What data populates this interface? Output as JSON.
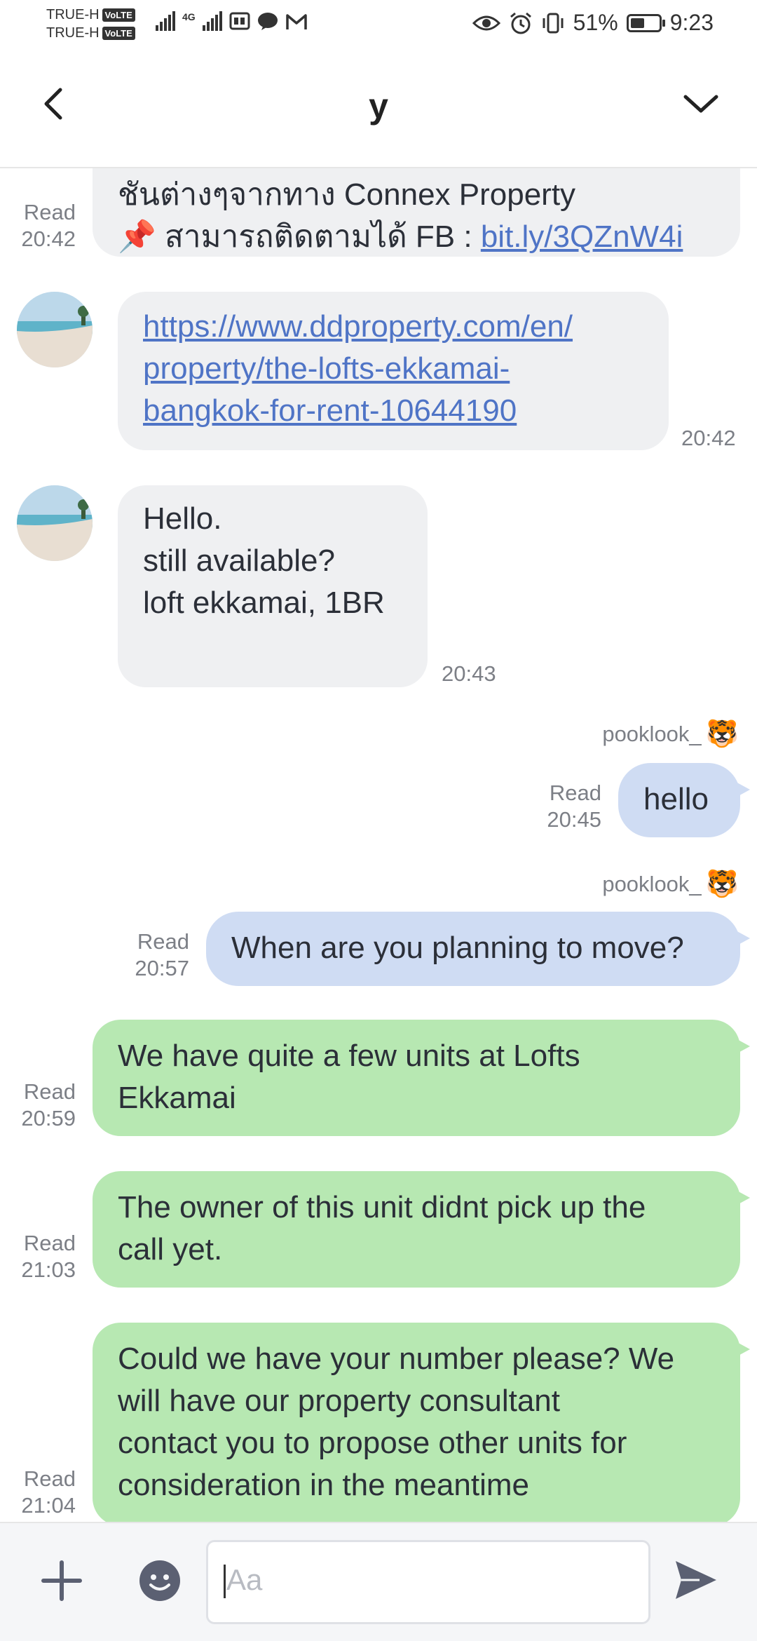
{
  "status_bar": {
    "carrier1": "TRUE-H",
    "carrier2": "TRUE-H",
    "volte": "VoLTE",
    "network": "4G",
    "battery_percent": "51%",
    "battery_level": 0.51,
    "time": "9:23"
  },
  "header": {
    "title": "y"
  },
  "messages": {
    "m1": {
      "line1": "ชันต่างๆจากทาง Connex Property",
      "line2_prefix": "📌 สามารถติดตามได้ FB : ",
      "line2_link": "bit.ly/3QZnW4i",
      "read": "Read",
      "time": "20:42"
    },
    "m2": {
      "link_line1": "https://www.ddproperty.com/en/",
      "link_line2": "property/the-lofts-ekkamai-",
      "link_line3": "bangkok-for-rent-10644190",
      "time": "20:42"
    },
    "m3": {
      "line1": "Hello.",
      "line2": "still available?",
      "line3": "loft ekkamai, 1BR",
      "time": "20:43"
    },
    "m4": {
      "sender": "pooklook_",
      "sender_emoji": "🐯",
      "text": "hello",
      "read": "Read",
      "time": "20:45"
    },
    "m5": {
      "sender": "pooklook_",
      "sender_emoji": "🐯",
      "text": "When are you planning to move?",
      "read": "Read",
      "time": "20:57"
    },
    "m6": {
      "line1": "We have quite a few units at Lofts",
      "line2": "Ekkamai",
      "read": "Read",
      "time": "20:59"
    },
    "m7": {
      "line1": "The owner of this unit didnt pick up the",
      "line2": "call yet.",
      "read": "Read",
      "time": "21:03"
    },
    "m8": {
      "line1": "Could we have your number please? We",
      "line2": "will have our property consultant",
      "line3": "contact you to propose other units for",
      "line4": "consideration in the meantime",
      "read": "Read",
      "time": "21:04"
    }
  },
  "input": {
    "placeholder": "Aa"
  },
  "colors": {
    "incoming_bubble": "#eff0f2",
    "outgoing_blue": "#cfdcf3",
    "outgoing_green": "#b7e8b2",
    "link": "#4f74c6"
  }
}
